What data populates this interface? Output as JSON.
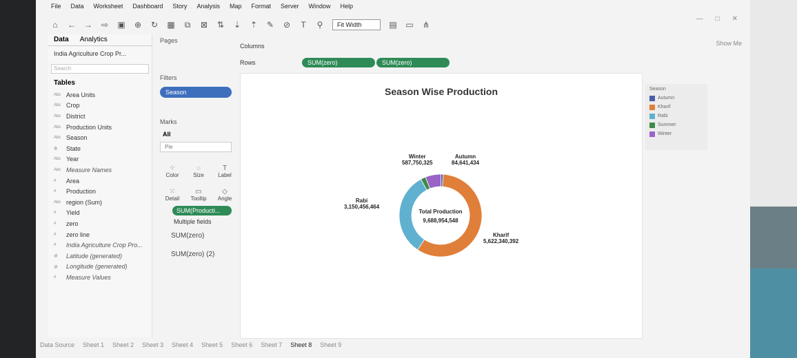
{
  "menu": [
    "File",
    "Data",
    "Worksheet",
    "Dashboard",
    "Story",
    "Analysis",
    "Map",
    "Format",
    "Server",
    "Window",
    "Help"
  ],
  "toolbar": {
    "fit": "Fit Width",
    "show_me": "Show Me"
  },
  "left": {
    "tabs": [
      "Data",
      "Analytics"
    ],
    "datasource": "India Agriculture Crop Pr...",
    "search_placeholder": "Search",
    "tables_heading": "Tables",
    "fields": [
      {
        "label": "Area Units",
        "italic": false,
        "type": "Abc"
      },
      {
        "label": "Crop",
        "italic": false,
        "type": "Abc"
      },
      {
        "label": "District",
        "italic": false,
        "type": "Abc"
      },
      {
        "label": "Production Units",
        "italic": false,
        "type": "Abc"
      },
      {
        "label": "Season",
        "italic": false,
        "type": "Abc"
      },
      {
        "label": "State",
        "italic": false,
        "type": "globe"
      },
      {
        "label": "Year",
        "italic": false,
        "type": "Abc"
      },
      {
        "label": "Measure Names",
        "italic": true,
        "type": "Abc"
      },
      {
        "label": "Area",
        "italic": false,
        "type": "#"
      },
      {
        "label": "Production",
        "italic": false,
        "type": "#"
      },
      {
        "label": "region (Sum)",
        "italic": false,
        "type": "Abc"
      },
      {
        "label": "Yield",
        "italic": false,
        "type": "#"
      },
      {
        "label": "zero",
        "italic": false,
        "type": "#"
      },
      {
        "label": "zero line",
        "italic": false,
        "type": "#"
      },
      {
        "label": "India Agriculture Crop Pro...",
        "italic": true,
        "type": "#"
      },
      {
        "label": "Latitude (generated)",
        "italic": true,
        "type": "globe"
      },
      {
        "label": "Longitude (generated)",
        "italic": true,
        "type": "globe"
      },
      {
        "label": "Measure Values",
        "italic": true,
        "type": "#"
      }
    ]
  },
  "mid": {
    "pages": "Pages",
    "filters": "Filters",
    "filter_pill": "Season",
    "marks": "Marks",
    "all": "All",
    "mark_type": "Pie",
    "cells": [
      "Color",
      "Size",
      "Label",
      "Detail",
      "Tooltip",
      "Angle"
    ],
    "sum_pill": "SUM(Producti...",
    "multiple_fields": "Multiple fields",
    "sum_zero": "SUM(zero)",
    "sum_zero_2": "SUM(zero) (2)"
  },
  "shelves": {
    "columns": "Columns",
    "rows": "Rows",
    "row_pills": [
      "SUM(zero)",
      "SUM(zero)"
    ]
  },
  "viz": {
    "title": "Season Wise Production",
    "center_title": "Total Production",
    "center_value": "9,688,954,548"
  },
  "chart_data": {
    "type": "pie",
    "title": "Season Wise Production",
    "categories": [
      "Autumn",
      "Kharif",
      "Rabi",
      "Summer",
      "Winter"
    ],
    "values": [
      84641434,
      5622340392,
      3150456464,
      188166000,
      587750325
    ],
    "labels": [
      {
        "name": "Winter",
        "value": "587,750,325"
      },
      {
        "name": "Autumn",
        "value": "84,641,434"
      },
      {
        "name": "Rabi",
        "value": "3,150,456,464"
      },
      {
        "name": "Kharif",
        "value": "5,622,340,392"
      }
    ],
    "colors": [
      "#4b5ea8",
      "#e07f3a",
      "#5fb1cf",
      "#3f8a4a",
      "#9a63c7"
    ],
    "legend_title": "Season",
    "legend_placement": "right"
  },
  "sheets": [
    "Data Source",
    "Sheet 1",
    "Sheet 2",
    "Sheet 3",
    "Sheet 4",
    "Sheet 5",
    "Sheet 6",
    "Sheet 7",
    "Sheet 8",
    "Sheet 9"
  ],
  "active_sheet": "Sheet 8"
}
